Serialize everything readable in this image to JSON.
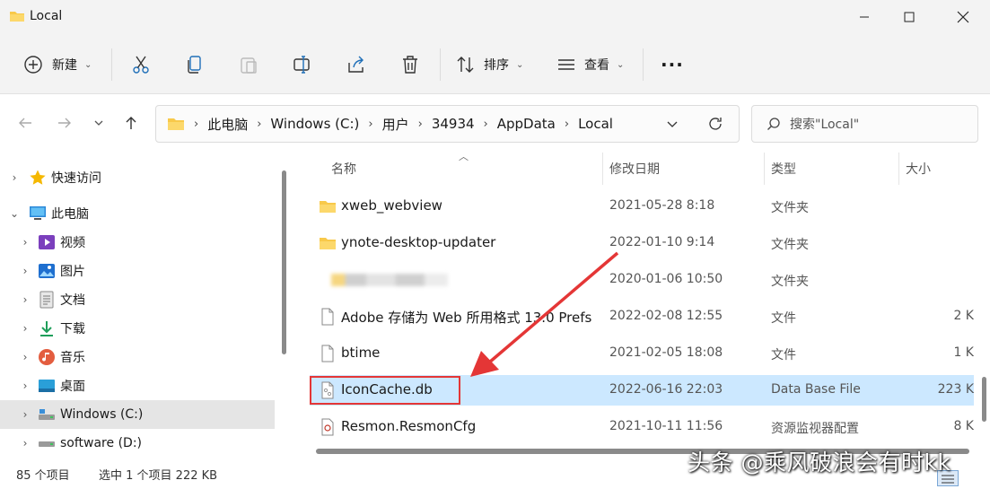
{
  "window": {
    "title": "Local"
  },
  "toolbar": {
    "new_label": "新建",
    "sort_label": "排序",
    "view_label": "查看",
    "more_label": "···"
  },
  "breadcrumb": [
    "此电脑",
    "Windows (C:)",
    "用户",
    "34934",
    "AppData",
    "Local"
  ],
  "search": {
    "placeholder": "搜索\"Local\""
  },
  "sidebar": {
    "items": [
      {
        "label": "快速访问",
        "icon": "star-icon"
      },
      {
        "label": "此电脑",
        "icon": "computer-icon"
      },
      {
        "label": "视频",
        "icon": "video-icon"
      },
      {
        "label": "图片",
        "icon": "pictures-icon"
      },
      {
        "label": "文档",
        "icon": "document-icon"
      },
      {
        "label": "下载",
        "icon": "download-icon"
      },
      {
        "label": "音乐",
        "icon": "music-icon"
      },
      {
        "label": "桌面",
        "icon": "desktop-icon"
      },
      {
        "label": "Windows (C:)",
        "icon": "drive-icon"
      },
      {
        "label": "software (D:)",
        "icon": "drive-icon"
      }
    ]
  },
  "columns": {
    "name": "名称",
    "date": "修改日期",
    "type": "类型",
    "size": "大小"
  },
  "files": [
    {
      "name": "xweb_webview",
      "date": "2021-05-28 8:18",
      "type": "文件夹",
      "size": "",
      "icon": "folder-icon"
    },
    {
      "name": "ynote-desktop-updater",
      "date": "2022-01-10 9:14",
      "type": "文件夹",
      "size": "",
      "icon": "folder-icon"
    },
    {
      "name": "",
      "date": "2020-01-06 10:50",
      "type": "文件夹",
      "size": "",
      "icon": "folder-icon"
    },
    {
      "name": "Adobe 存储为 Web 所用格式 13.0 Prefs",
      "date": "2022-02-08 12:55",
      "type": "文件",
      "size": "2 K",
      "icon": "file-icon"
    },
    {
      "name": "btime",
      "date": "2021-02-05 18:08",
      "type": "文件",
      "size": "1 K",
      "icon": "file-icon"
    },
    {
      "name": "IconCache.db",
      "date": "2022-06-16 22:03",
      "type": "Data Base File",
      "size": "223 K",
      "icon": "database-file-icon"
    },
    {
      "name": "Resmon.ResmonCfg",
      "date": "2021-10-11 11:56",
      "type": "资源监视器配置",
      "size": "8 K",
      "icon": "resmon-file-icon"
    }
  ],
  "status": {
    "count": "85 个项目",
    "selection": "选中 1 个项目  222 KB"
  },
  "watermark": "头条 @乘风破浪会有时kk",
  "colors": {
    "accent": "#0067c0",
    "selection": "#cce8ff",
    "annotation": "#e43636"
  }
}
